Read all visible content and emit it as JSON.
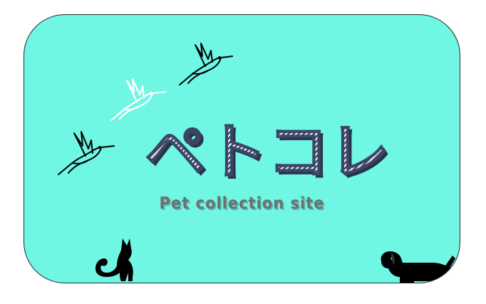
{
  "banner": {
    "title": "ペトコレ",
    "subtitle": "Pet collection site"
  },
  "colors": {
    "card_background": "#6ff7e4",
    "title_fill_dark": "#3b4663",
    "title_fill_light": "#dfe3ee",
    "subtitle": "#6f6f6f",
    "silhouette": "#000000"
  },
  "icons": {
    "birds": [
      "hummingbird-icon",
      "hummingbird-icon",
      "hummingbird-icon"
    ],
    "cat": "cat-silhouette-icon",
    "dog": "dog-silhouette-icon"
  }
}
